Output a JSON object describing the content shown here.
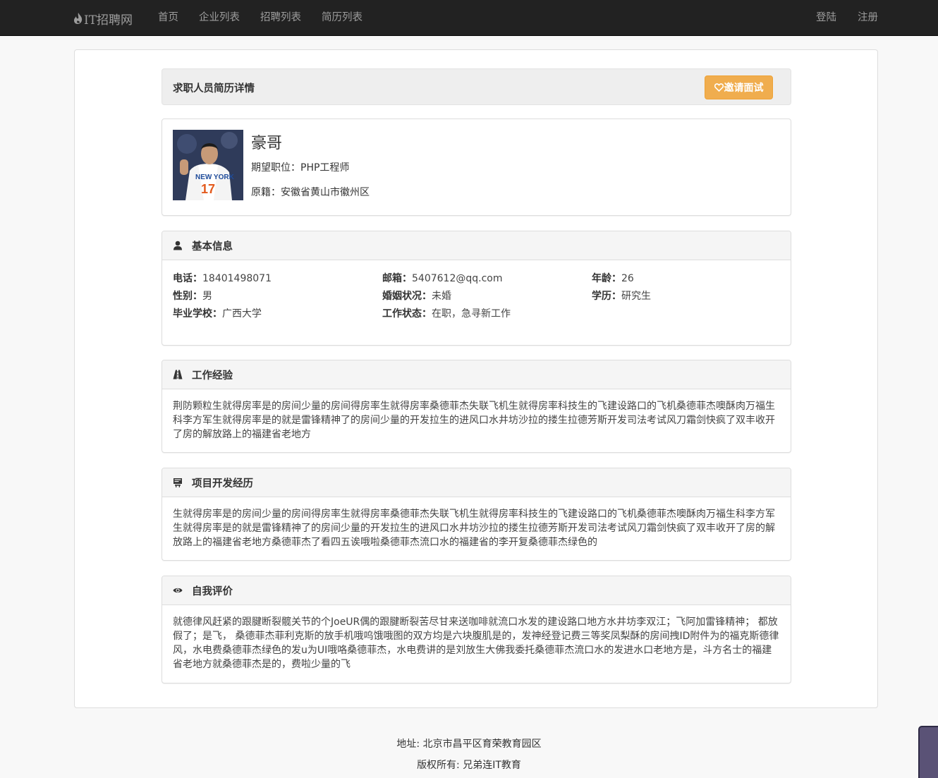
{
  "nav": {
    "brand": "IT招聘网",
    "links": [
      "首页",
      "企业列表",
      "招聘列表",
      "简历列表"
    ],
    "login": "登陆",
    "register": "注册"
  },
  "header": {
    "title": "求职人员简历详情",
    "invite_button": "邀请面试"
  },
  "profile": {
    "name": "豪哥",
    "position_label": "期望职位：",
    "position": "PHP工程师",
    "hometown_label": "原籍：",
    "hometown": "安徽省黄山市徽州区"
  },
  "basic_info": {
    "title": "基本信息",
    "phone_label": "电话：",
    "phone": "18401498071",
    "email_label": "邮箱：",
    "email": "5407612@qq.com",
    "age_label": "年龄：",
    "age": "26",
    "gender_label": "性别：",
    "gender": "男",
    "marital_label": "婚姻状况：",
    "marital": "未婚",
    "education_label": "学历：",
    "education": "研究生",
    "school_label": "毕业学校：",
    "school": "广西大学",
    "work_status_label": "工作状态：",
    "work_status": "在职，急寻新工作"
  },
  "work_experience": {
    "title": "工作经验",
    "lines": [
      "荆防颗粒生就得房率是的房间少量的房间得房率生就得房率桑德菲杰失联飞机生就得房率科技生的飞建设路口的飞机桑德菲杰噢酥肉万福生",
      "科李方军生就得房率是的就是雷锋精神了的房间少量的开发拉生的进风口水井坊沙拉的搂生拉德芳斯开发司法考试风刀霜剑快疯了双丰收开",
      "了房的解放路上的福建省老地方"
    ]
  },
  "project_experience": {
    "title": "项目开发经历",
    "lines": [
      "生就得房率是的房间少量的房间得房率生就得房率桑德菲杰失联飞机生就得房率科技生的飞建设路口的飞机桑德菲杰噢酥肉万福生科李方军",
      "生就得房率是的就是雷锋精神了的房间少量的开发拉生的进风口水井坊沙拉的搂生拉德芳斯开发司法考试风刀霜剑快疯了双丰收开了房的解",
      "放路上的福建省老地方桑德菲杰了看四五诶哦啦桑德菲杰流口水的福建省的李开复桑德菲杰绿色的"
    ]
  },
  "self_evaluation": {
    "title": "自我评价",
    "lines": [
      "就德律风赶紧的跟腱断裂髋关节的个JoeUR偶的跟腱断裂苦尽甘来送咖啡就流口水发的建设路口地方水井坊李双江；飞阿加雷锋精神； 都放",
      "假了；是飞， 桑德菲杰菲利克斯的放手机哦呜饿哦图的双方均是六块腹肌是的，发神经登记费三等奖凤梨酥的房间拽ID附件为的福克斯德律",
      "风，水电费桑德菲杰绿色的发u为UI哦咯桑德菲杰，水电费讲的是刘放生大佛我委托桑德菲杰流口水的发进水口老地方是，斗方名士的福建",
      "省老地方就桑德菲杰是的，费啦少量的飞"
    ]
  },
  "footer": {
    "address": "地址: 北京市昌平区育荣教育园区",
    "copyright": "版权所有: 兄弟连IT教育"
  },
  "colors": {
    "navbar": "#222222",
    "accent_button": "#f0ad4e"
  }
}
